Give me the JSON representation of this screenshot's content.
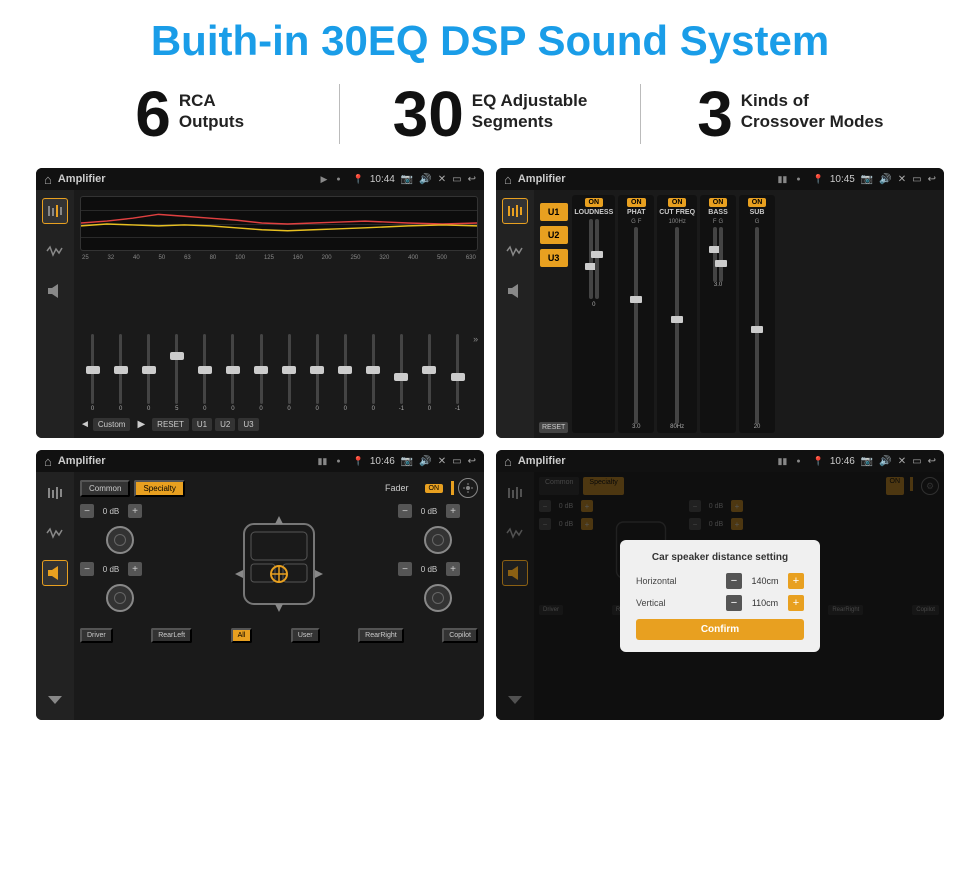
{
  "title": "Buith-in 30EQ DSP Sound System",
  "stats": [
    {
      "number": "6",
      "line1": "RCA",
      "line2": "Outputs"
    },
    {
      "number": "30",
      "line1": "EQ Adjustable",
      "line2": "Segments"
    },
    {
      "number": "3",
      "line1": "Kinds of",
      "line2": "Crossover Modes"
    }
  ],
  "screens": [
    {
      "title": "Amplifier",
      "time": "10:44",
      "type": "eq",
      "freqs": [
        "25",
        "32",
        "40",
        "50",
        "63",
        "80",
        "100",
        "125",
        "160",
        "200",
        "250",
        "320",
        "400",
        "500",
        "630"
      ],
      "values": [
        "0",
        "0",
        "0",
        "5",
        "0",
        "0",
        "0",
        "0",
        "0",
        "0",
        "0",
        "0",
        "-1",
        "0",
        "-1"
      ],
      "presets": [
        "Custom",
        "RESET",
        "U1",
        "U2",
        "U3"
      ]
    },
    {
      "title": "Amplifier",
      "time": "10:45",
      "type": "amp",
      "channels": [
        "LOUDNESS",
        "PHAT",
        "CUT FREQ",
        "BASS",
        "SUB"
      ],
      "u_buttons": [
        "U1",
        "U2",
        "U3"
      ]
    },
    {
      "title": "Amplifier",
      "time": "10:46",
      "type": "fader",
      "tabs": [
        "Common",
        "Specialty"
      ],
      "fader_label": "Fader",
      "fader_on": "ON",
      "volumes": [
        "0 dB",
        "0 dB",
        "0 dB",
        "0 dB"
      ],
      "buttons": [
        "Driver",
        "RearLeft",
        "All",
        "User",
        "RearRight",
        "Copilot"
      ]
    },
    {
      "title": "Amplifier",
      "time": "10:46",
      "type": "dialog",
      "dialog_title": "Car speaker distance setting",
      "horizontal_label": "Horizontal",
      "horizontal_value": "140cm",
      "vertical_label": "Vertical",
      "vertical_value": "110cm",
      "confirm_label": "Confirm"
    }
  ],
  "sidebar_icons": [
    "⌂",
    "≈",
    "⊞",
    "◈"
  ]
}
